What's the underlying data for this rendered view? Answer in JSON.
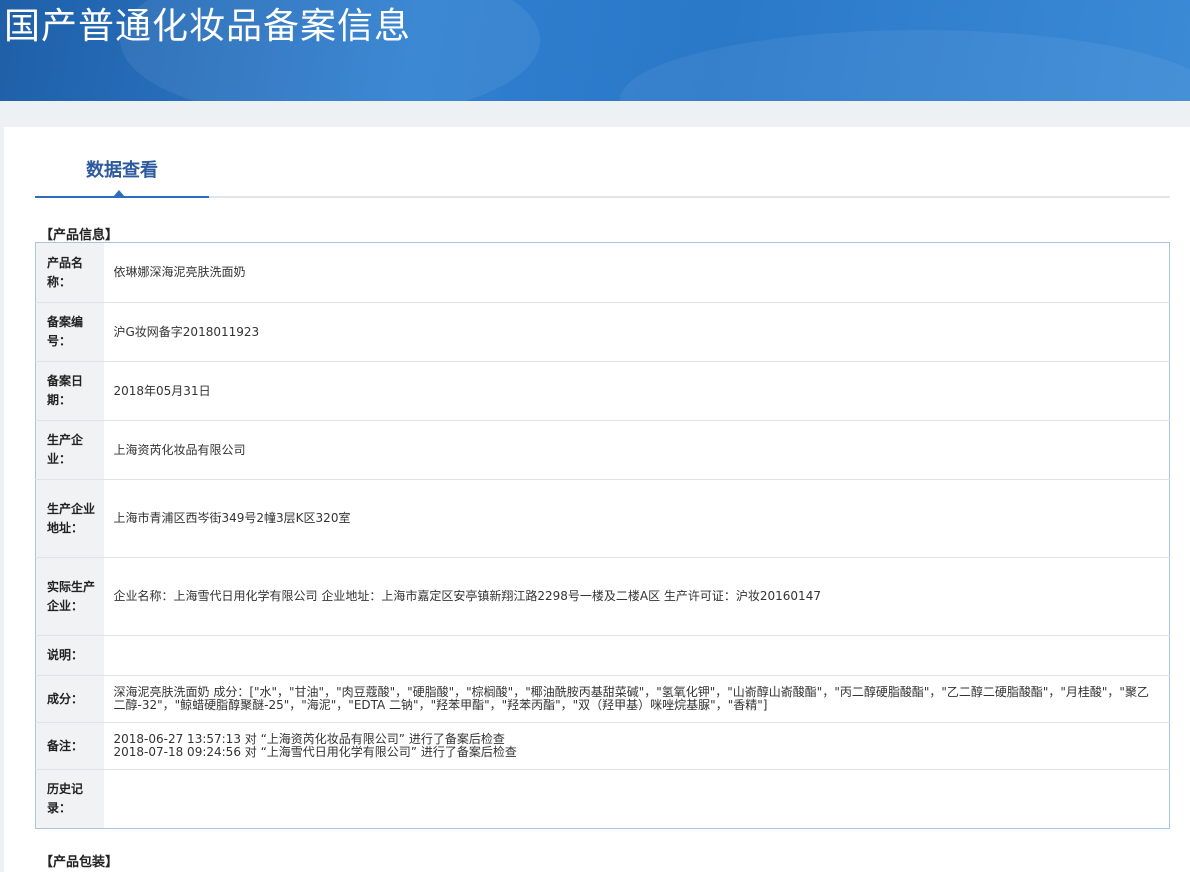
{
  "header": {
    "title": "国产普通化妆品备案信息"
  },
  "tabs": [
    {
      "label": "数据查看"
    }
  ],
  "product_info": {
    "section_title": "【产品信息】",
    "rows": [
      {
        "label": "产品名称：",
        "value": "依琳娜深海泥亮肤洗面奶"
      },
      {
        "label": "备案编号：",
        "value": "沪G妆网备字2018011923"
      },
      {
        "label": "备案日期：",
        "value": "2018年05月31日"
      },
      {
        "label": "生产企业：",
        "value": "上海资芮化妆品有限公司"
      },
      {
        "label": "生产企业地址：",
        "value": "上海市青浦区西岑街349号2幢3层K区320室"
      },
      {
        "label": "实际生产企业：",
        "value": "企业名称：上海雪代日用化学有限公司 企业地址：上海市嘉定区安亭镇新翔江路2298号一楼及二楼A区 生产许可证：沪妆20160147"
      },
      {
        "label": "说明：",
        "value": ""
      },
      {
        "label": "成分：",
        "value": "深海泥亮肤洗面奶 成分：[\"水\"，\"甘油\"，\"肉豆蔻酸\"，\"硬脂酸\"，\"棕榈酸\"，\"椰油酰胺丙基甜菜碱\"，\"氢氧化钾\"，\"山嵛醇山嵛酸酯\"，\"丙二醇硬脂酸酯\"，\"乙二醇二硬脂酸酯\"，\"月桂酸\"，\"聚乙二醇-32\"，\"鲸蜡硬脂醇聚醚-25\"，\"海泥\"，\"EDTA 二钠\"，\"羟苯甲酯\"，\"羟苯丙酯\"，\"双（羟甲基）咪唑烷基脲\"，\"香精\"]"
      },
      {
        "label": "备注：",
        "lines": [
          "2018-06-27 13:57:13 对 “上海资芮化妆品有限公司” 进行了备案后检查",
          "2018-07-18 09:24:56 对 “上海雪代日用化学有限公司” 进行了备案后检查"
        ]
      },
      {
        "label": "历史记录：",
        "value": ""
      }
    ]
  },
  "packaging": {
    "section_title": "【产品包装】"
  },
  "colors": {
    "accent": "#2d6cbe",
    "banner": "#2a78c8",
    "table_border": "#a9c3e0"
  }
}
